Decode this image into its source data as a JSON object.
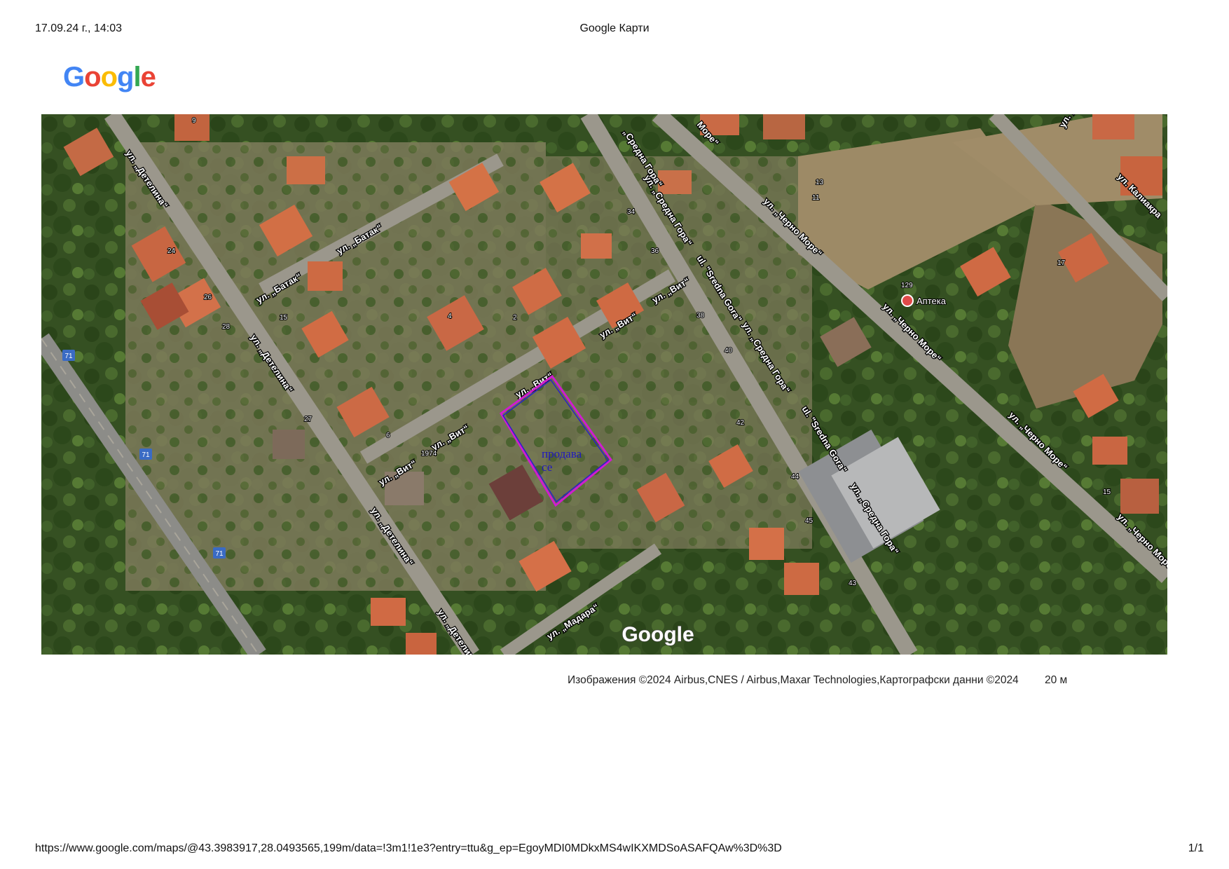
{
  "header": {
    "datetime": "17.09.24 г., 14:03",
    "title": "Google Карти"
  },
  "logo": {
    "text": "Google",
    "colors": [
      "#4285F4",
      "#EA4335",
      "#FBBC05",
      "#4285F4",
      "#34A853",
      "#EA4335"
    ]
  },
  "map": {
    "view": "satellite",
    "watermark": "Google",
    "streets": {
      "detelina": "ул. „Детелина“",
      "batak": "ул. „Батак“",
      "vit": "ул. „Вит“",
      "sredna_gora": "ул. „Средна Гора“",
      "sredna_gora_lat": "ul. \"Sredna Gora\"",
      "cherno_more": "ул. „Черно Море“",
      "madara": "ул. „Мадара“",
      "kaliakra": "ул. Калиакра",
      "kaliakra_short": "ул. „Калиакра",
      "sredna_gora_short": "„Средна Гора“",
      "more_short": "Море“",
      "detelina_short": "ул. „Детелина“"
    },
    "poi": {
      "pharmacy": "Аптека"
    },
    "route_badge": "71",
    "parcel_label": [
      "продава",
      "се"
    ],
    "house_numbers": [
      "9",
      "24",
      "26",
      "28",
      "15",
      "4",
      "2",
      "34",
      "36",
      "38",
      "40",
      "13",
      "11",
      "17",
      "42",
      "44",
      "45",
      "43",
      "27",
      "1974",
      "129",
      "15",
      "6"
    ]
  },
  "attribution": "Изображения ©2024 Airbus,CNES / Airbus,Maxar Technologies,Картографски данни ©2024",
  "scale_label": "20 м",
  "footer": {
    "url": "https://www.google.com/maps/@43.3983917,28.0493565,199m/data=!3m1!1e3?entry=ttu&g_ep=EgoyMDI0MDkxMS4wIKXMDSoASAFQAw%3D%3D",
    "page": "1/1"
  }
}
